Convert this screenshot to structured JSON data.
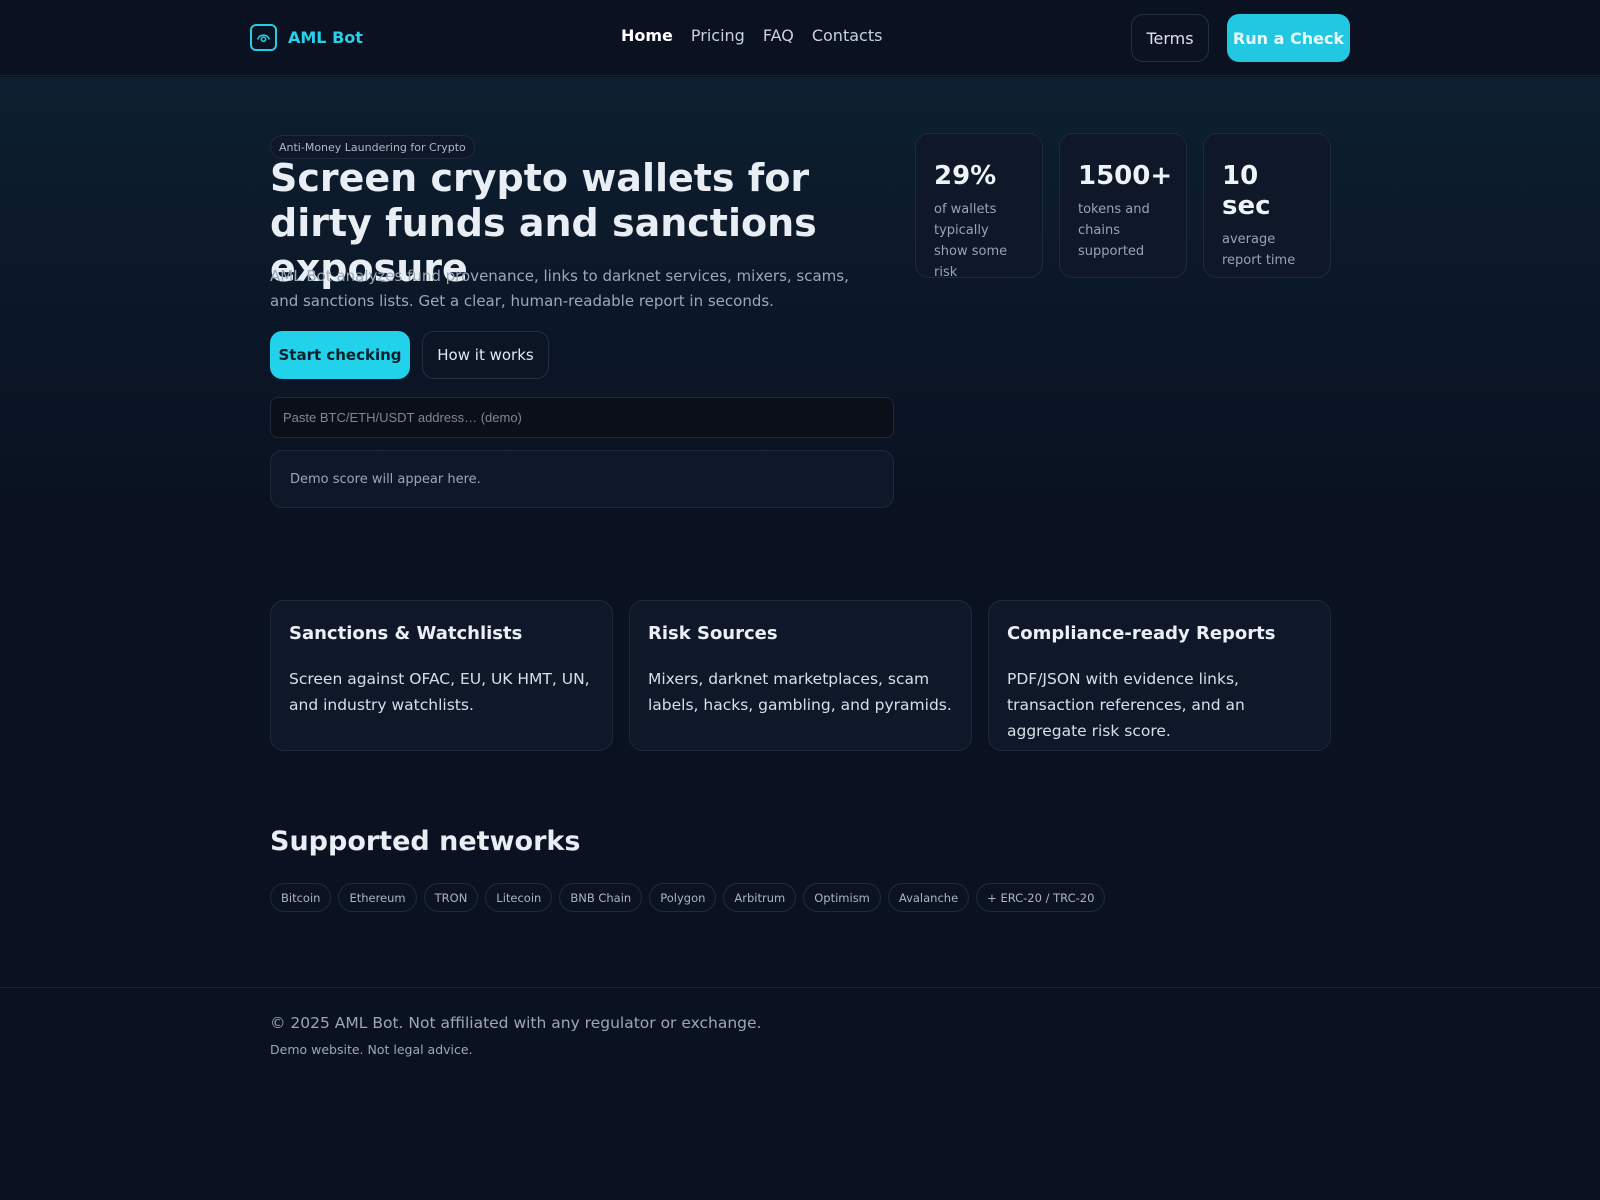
{
  "header": {
    "brand": "AML Bot",
    "nav": [
      {
        "label": "Home",
        "active": true
      },
      {
        "label": "Pricing",
        "active": false
      },
      {
        "label": "FAQ",
        "active": false
      },
      {
        "label": "Contacts",
        "active": false
      }
    ],
    "terms_label": "Terms",
    "run_check_label": "Run a Check"
  },
  "hero": {
    "tag": "Anti-Money Laundering for Crypto",
    "title": "Screen crypto wallets for dirty funds and sanctions exposure",
    "description": "AML Bot analyzes fund provenance, links to darknet services, mixers, scams, and sanctions lists. Get a clear, human-readable report in seconds.",
    "start_label": "Start checking",
    "how_label": "How it works",
    "address_placeholder": "Paste BTC/ETH/USDT address… (demo)",
    "address_value": "",
    "score_text": "Demo score will appear here."
  },
  "stats": [
    {
      "value": "29%",
      "label": "of wallets typically show some risk"
    },
    {
      "value": "1500+",
      "label": "tokens and chains supported"
    },
    {
      "value": "10 sec",
      "label": "average report time"
    }
  ],
  "features": [
    {
      "title": "Sanctions & Watchlists",
      "text": "Screen against OFAC, EU, UK HMT, UN, and industry watchlists."
    },
    {
      "title": "Risk Sources",
      "text": "Mixers, darknet marketplaces, scam labels, hacks, gambling, and pyramids."
    },
    {
      "title": "Compliance-ready Reports",
      "text": "PDF/JSON with evidence links, transaction references, and an aggregate risk score."
    }
  ],
  "networks": {
    "title": "Supported networks",
    "items": [
      "Bitcoin",
      "Ethereum",
      "TRON",
      "Litecoin",
      "BNB Chain",
      "Polygon",
      "Arbitrum",
      "Optimism",
      "Avalanche",
      "+ ERC-20 / TRC-20"
    ]
  },
  "footer": {
    "copyright": "© 2025 AML Bot. Not affiliated with any regulator or exchange.",
    "note": "Demo website. Not legal advice."
  },
  "colors": {
    "background": "#0a1120",
    "accent": "#22d1ea",
    "card": "#0f1828"
  },
  "icons": {
    "brand": "eye-shield-icon"
  }
}
